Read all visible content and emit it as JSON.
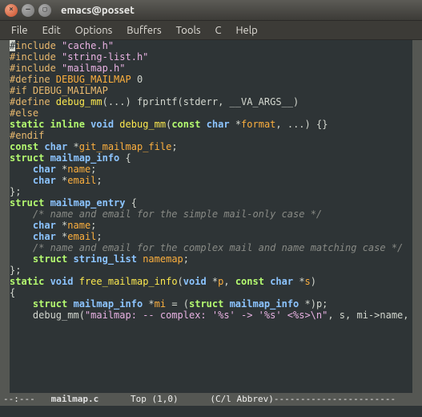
{
  "window": {
    "title": "emacs@posset"
  },
  "menubar": {
    "items": [
      "File",
      "Edit",
      "Options",
      "Buffers",
      "Tools",
      "C",
      "Help"
    ]
  },
  "code": {
    "lines": [
      {
        "segs": [
          {
            "c": "cursor",
            "t": "#"
          },
          {
            "c": "pp",
            "t": "include "
          },
          {
            "c": "str",
            "t": "\"cache.h\""
          }
        ]
      },
      {
        "segs": [
          {
            "c": "pp",
            "t": "#include "
          },
          {
            "c": "str",
            "t": "\"string-list.h\""
          }
        ]
      },
      {
        "segs": [
          {
            "c": "pp",
            "t": "#include "
          },
          {
            "c": "str",
            "t": "\"mailmap.h\""
          }
        ]
      },
      {
        "segs": [
          {
            "c": "",
            "t": ""
          }
        ]
      },
      {
        "segs": [
          {
            "c": "pp",
            "t": "#define "
          },
          {
            "c": "var",
            "t": "DEBUG_MAILMAP"
          },
          {
            "c": "",
            "t": " 0"
          }
        ]
      },
      {
        "segs": [
          {
            "c": "pp",
            "t": "#if DEBUG_MAILMAP"
          }
        ]
      },
      {
        "segs": [
          {
            "c": "pp",
            "t": "#define "
          },
          {
            "c": "fn",
            "t": "debug_mm"
          },
          {
            "c": "",
            "t": "(...) fprintf(stderr, __VA_ARGS__)"
          }
        ]
      },
      {
        "segs": [
          {
            "c": "pp",
            "t": "#else"
          }
        ]
      },
      {
        "segs": [
          {
            "c": "kw",
            "t": "static inline "
          },
          {
            "c": "type",
            "t": "void"
          },
          {
            "c": "",
            "t": " "
          },
          {
            "c": "fn",
            "t": "debug_mm"
          },
          {
            "c": "",
            "t": "("
          },
          {
            "c": "kw",
            "t": "const "
          },
          {
            "c": "type",
            "t": "char"
          },
          {
            "c": "",
            "t": " *"
          },
          {
            "c": "var",
            "t": "format"
          },
          {
            "c": "",
            "t": ", ...) {}"
          }
        ]
      },
      {
        "segs": [
          {
            "c": "pp",
            "t": "#endif"
          }
        ]
      },
      {
        "segs": [
          {
            "c": "",
            "t": ""
          }
        ]
      },
      {
        "segs": [
          {
            "c": "kw",
            "t": "const "
          },
          {
            "c": "type",
            "t": "char"
          },
          {
            "c": "",
            "t": " *"
          },
          {
            "c": "var",
            "t": "git_mailmap_file"
          },
          {
            "c": "",
            "t": ";"
          }
        ]
      },
      {
        "segs": [
          {
            "c": "",
            "t": ""
          }
        ]
      },
      {
        "segs": [
          {
            "c": "kw",
            "t": "struct "
          },
          {
            "c": "type",
            "t": "mailmap_info"
          },
          {
            "c": "",
            "t": " {"
          }
        ]
      },
      {
        "segs": [
          {
            "c": "",
            "t": "    "
          },
          {
            "c": "type",
            "t": "char"
          },
          {
            "c": "",
            "t": " *"
          },
          {
            "c": "var",
            "t": "name"
          },
          {
            "c": "",
            "t": ";"
          }
        ]
      },
      {
        "segs": [
          {
            "c": "",
            "t": "    "
          },
          {
            "c": "type",
            "t": "char"
          },
          {
            "c": "",
            "t": " *"
          },
          {
            "c": "var",
            "t": "email"
          },
          {
            "c": "",
            "t": ";"
          }
        ]
      },
      {
        "segs": [
          {
            "c": "",
            "t": "};"
          }
        ]
      },
      {
        "segs": [
          {
            "c": "",
            "t": ""
          }
        ]
      },
      {
        "segs": [
          {
            "c": "kw",
            "t": "struct "
          },
          {
            "c": "type",
            "t": "mailmap_entry"
          },
          {
            "c": "",
            "t": " {"
          }
        ]
      },
      {
        "segs": [
          {
            "c": "",
            "t": "    "
          },
          {
            "c": "cm",
            "t": "/* name and email for the simple mail-only case */"
          }
        ]
      },
      {
        "segs": [
          {
            "c": "",
            "t": "    "
          },
          {
            "c": "type",
            "t": "char"
          },
          {
            "c": "",
            "t": " *"
          },
          {
            "c": "var",
            "t": "name"
          },
          {
            "c": "",
            "t": ";"
          }
        ]
      },
      {
        "segs": [
          {
            "c": "",
            "t": "    "
          },
          {
            "c": "type",
            "t": "char"
          },
          {
            "c": "",
            "t": " *"
          },
          {
            "c": "var",
            "t": "email"
          },
          {
            "c": "",
            "t": ";"
          }
        ]
      },
      {
        "segs": [
          {
            "c": "",
            "t": ""
          }
        ]
      },
      {
        "segs": [
          {
            "c": "",
            "t": "    "
          },
          {
            "c": "cm",
            "t": "/* name and email for the complex mail and name matching case */"
          }
        ]
      },
      {
        "segs": [
          {
            "c": "",
            "t": "    "
          },
          {
            "c": "kw",
            "t": "struct "
          },
          {
            "c": "type",
            "t": "string_list"
          },
          {
            "c": "",
            "t": " "
          },
          {
            "c": "var",
            "t": "namemap"
          },
          {
            "c": "",
            "t": ";"
          }
        ]
      },
      {
        "segs": [
          {
            "c": "",
            "t": "};"
          }
        ]
      },
      {
        "segs": [
          {
            "c": "",
            "t": ""
          }
        ]
      },
      {
        "segs": [
          {
            "c": "kw",
            "t": "static "
          },
          {
            "c": "type",
            "t": "void"
          },
          {
            "c": "",
            "t": " "
          },
          {
            "c": "fn",
            "t": "free_mailmap_info"
          },
          {
            "c": "",
            "t": "("
          },
          {
            "c": "type",
            "t": "void"
          },
          {
            "c": "",
            "t": " *"
          },
          {
            "c": "var",
            "t": "p"
          },
          {
            "c": "",
            "t": ", "
          },
          {
            "c": "kw",
            "t": "const "
          },
          {
            "c": "type",
            "t": "char"
          },
          {
            "c": "",
            "t": " *"
          },
          {
            "c": "var",
            "t": "s"
          },
          {
            "c": "",
            "t": ")"
          }
        ]
      },
      {
        "segs": [
          {
            "c": "",
            "t": "{"
          }
        ]
      },
      {
        "segs": [
          {
            "c": "",
            "t": "    "
          },
          {
            "c": "kw",
            "t": "struct "
          },
          {
            "c": "type",
            "t": "mailmap_info"
          },
          {
            "c": "",
            "t": " *"
          },
          {
            "c": "var",
            "t": "mi"
          },
          {
            "c": "",
            "t": " = ("
          },
          {
            "c": "kw",
            "t": "struct "
          },
          {
            "c": "type",
            "t": "mailmap_info"
          },
          {
            "c": "",
            "t": " *)p;"
          }
        ]
      },
      {
        "segs": [
          {
            "c": "",
            "t": "    debug_mm("
          },
          {
            "c": "str",
            "t": "\"mailmap: -- complex: '%s' -> '%s' <%s>\\n\""
          },
          {
            "c": "",
            "t": ", s, mi->name,"
          }
        ]
      }
    ]
  },
  "modeline": {
    "left": "--:---",
    "buffer": "mailmap.c",
    "position": "Top (1,0)",
    "modes": "(C/l Abbrev)",
    "dashes": "-----------------------"
  },
  "minibuffer": {
    "text": ""
  }
}
